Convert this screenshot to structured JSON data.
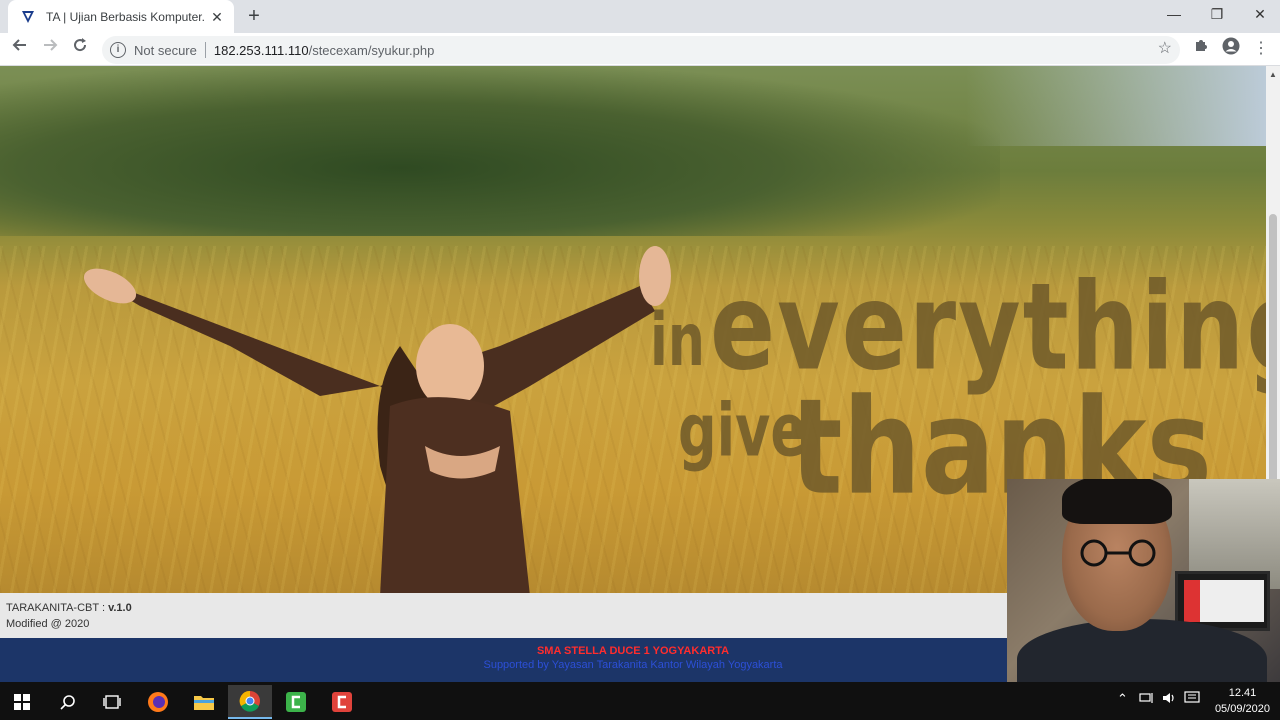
{
  "tab": {
    "title": "TA | Ujian Berbasis Komputer.... S"
  },
  "omnibox": {
    "security_label": "Not secure",
    "url_host": "182.253.111.110",
    "url_path": "/stecexam/syukur.php"
  },
  "hero": {
    "quote_line1_small": "in",
    "quote_line1_big": "everything",
    "quote_line2_small": "give",
    "quote_line2_big": "thanks"
  },
  "version": {
    "app_name": "TARAKANITA-CBT :",
    "version": "v.1.0",
    "modified": "Modified @ 2020"
  },
  "footer": {
    "school": "SMA STELLA DUCE 1 YOGYAKARTA",
    "support": "Supported by Yayasan Tarakanita Kantor Wilayah Yogyakarta"
  },
  "taskbar": {
    "time": "12.41",
    "date": "05/09/2020"
  },
  "colors": {
    "footer_bg": "#1c3568",
    "school_text": "#ff2d2d",
    "support_text": "#2c4fd6"
  },
  "icons": {
    "tab_favicon": "shield-logo-icon",
    "back": "arrow-left-icon",
    "forward": "arrow-right-icon",
    "reload": "reload-icon",
    "info": "info-icon",
    "bookmark": "star-icon",
    "extensions": "puzzle-icon",
    "profile": "account-icon",
    "menu": "kebab-menu-icon"
  }
}
